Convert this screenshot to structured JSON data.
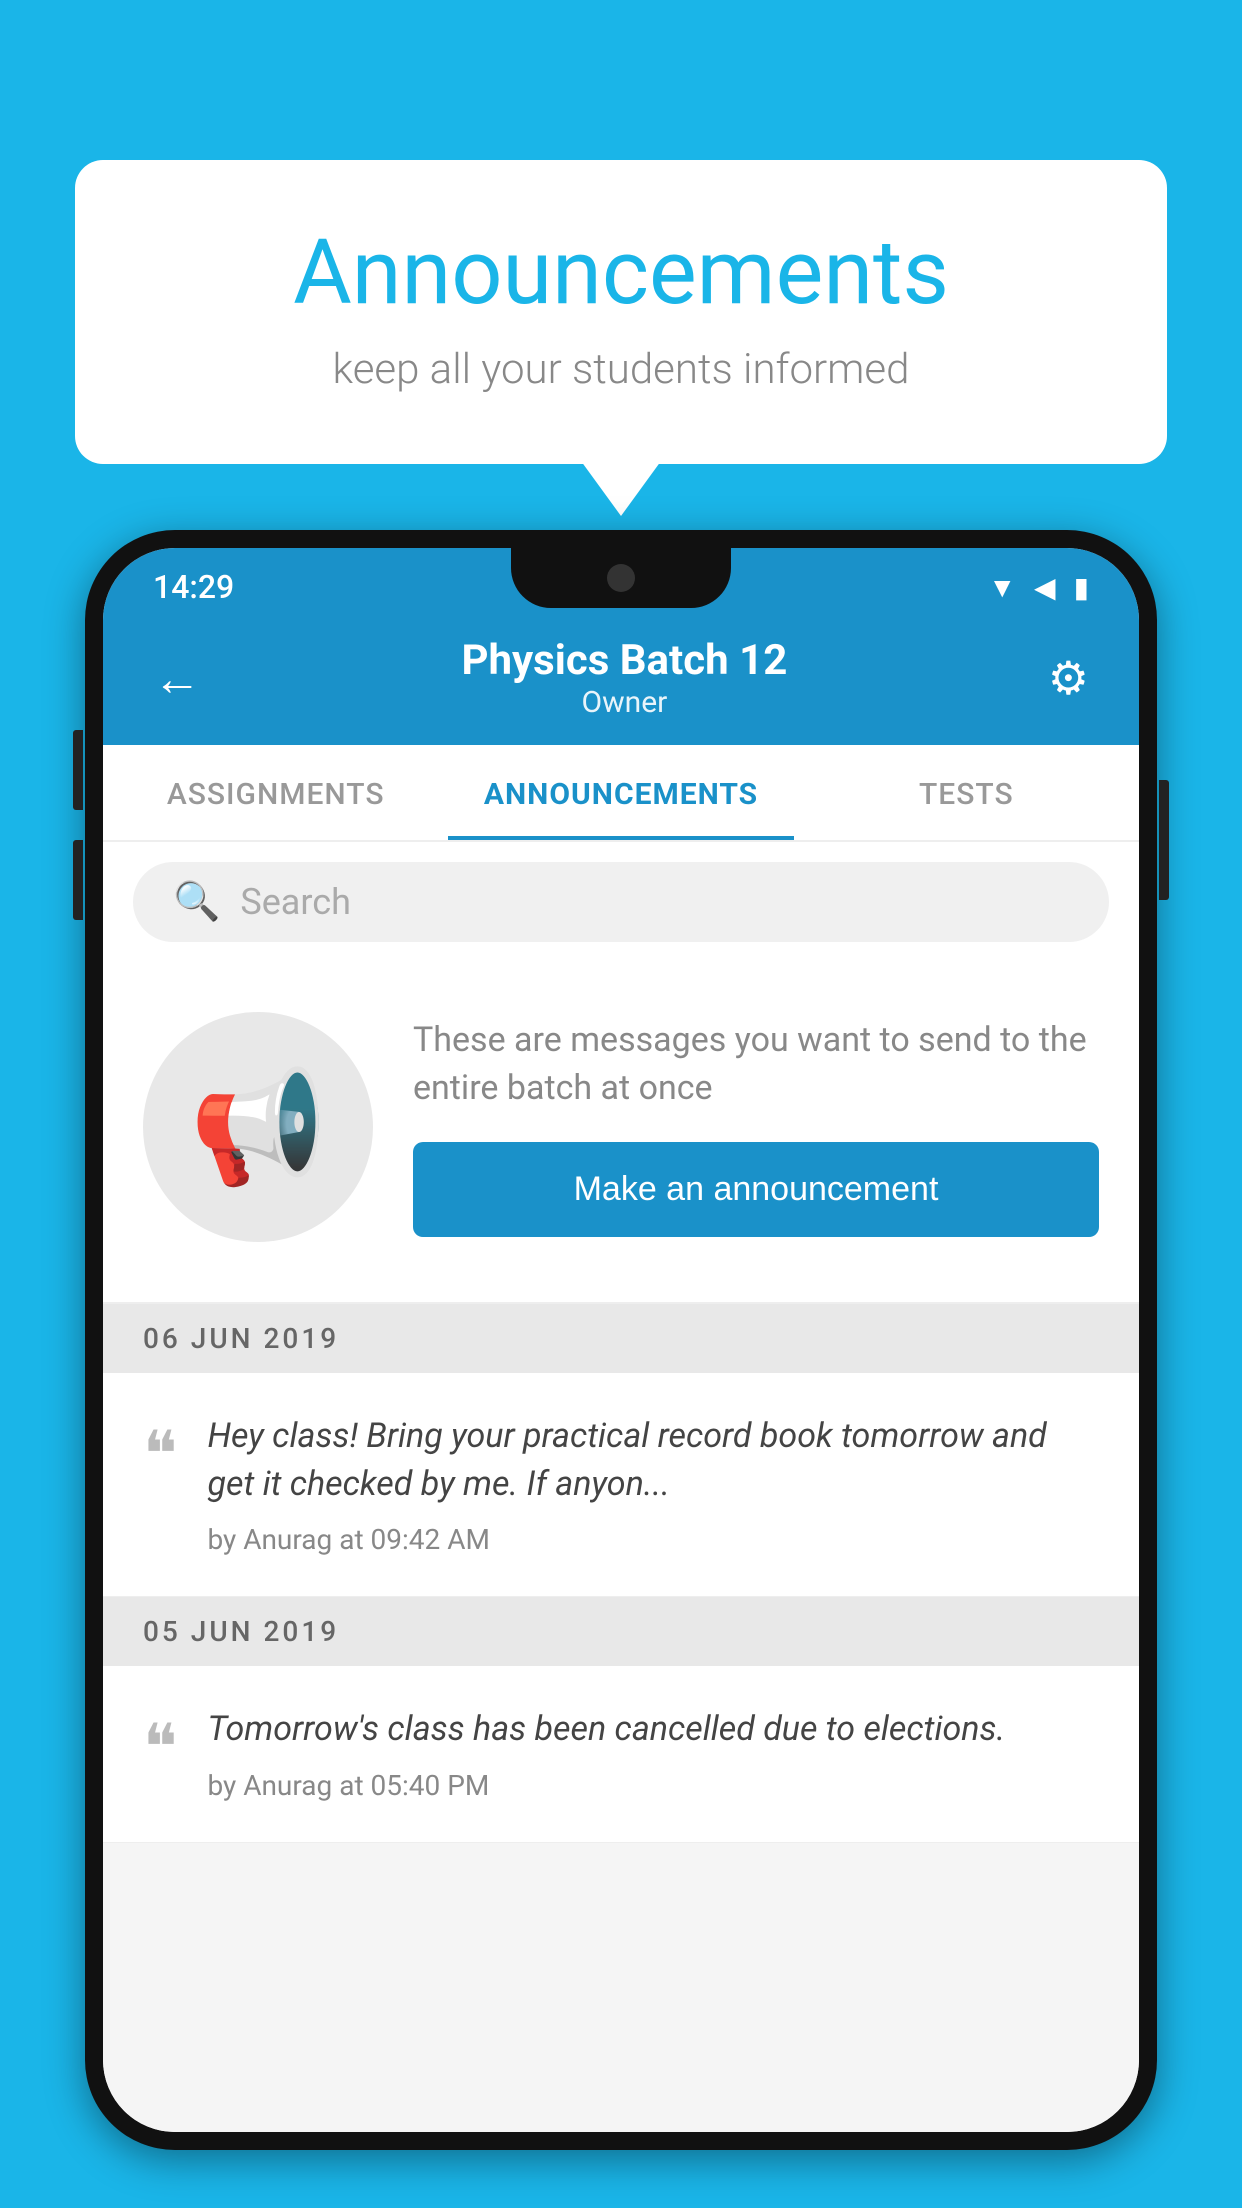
{
  "background_color": "#1ab5e8",
  "speech_bubble": {
    "title": "Announcements",
    "subtitle": "keep all your students informed"
  },
  "status_bar": {
    "time": "14:29",
    "wifi": "▲",
    "signal": "▲",
    "battery": "▐"
  },
  "header": {
    "title": "Physics Batch 12",
    "subtitle": "Owner",
    "back_label": "←",
    "gear_label": "⚙"
  },
  "tabs": [
    {
      "label": "ASSIGNMENTS",
      "active": false
    },
    {
      "label": "ANNOUNCEMENTS",
      "active": true
    },
    {
      "label": "TESTS",
      "active": false
    }
  ],
  "search": {
    "placeholder": "Search"
  },
  "promo": {
    "description": "These are messages you want to send to the entire batch at once",
    "button_label": "Make an announcement"
  },
  "date_groups": [
    {
      "date": "06  JUN  2019",
      "announcements": [
        {
          "text": "Hey class! Bring your practical record book tomorrow and get it checked by me. If anyon...",
          "meta": "by Anurag at 09:42 AM"
        }
      ]
    },
    {
      "date": "05  JUN  2019",
      "announcements": [
        {
          "text": "Tomorrow's class has been cancelled due to elections.",
          "meta": "by Anurag at 05:40 PM"
        }
      ]
    }
  ]
}
